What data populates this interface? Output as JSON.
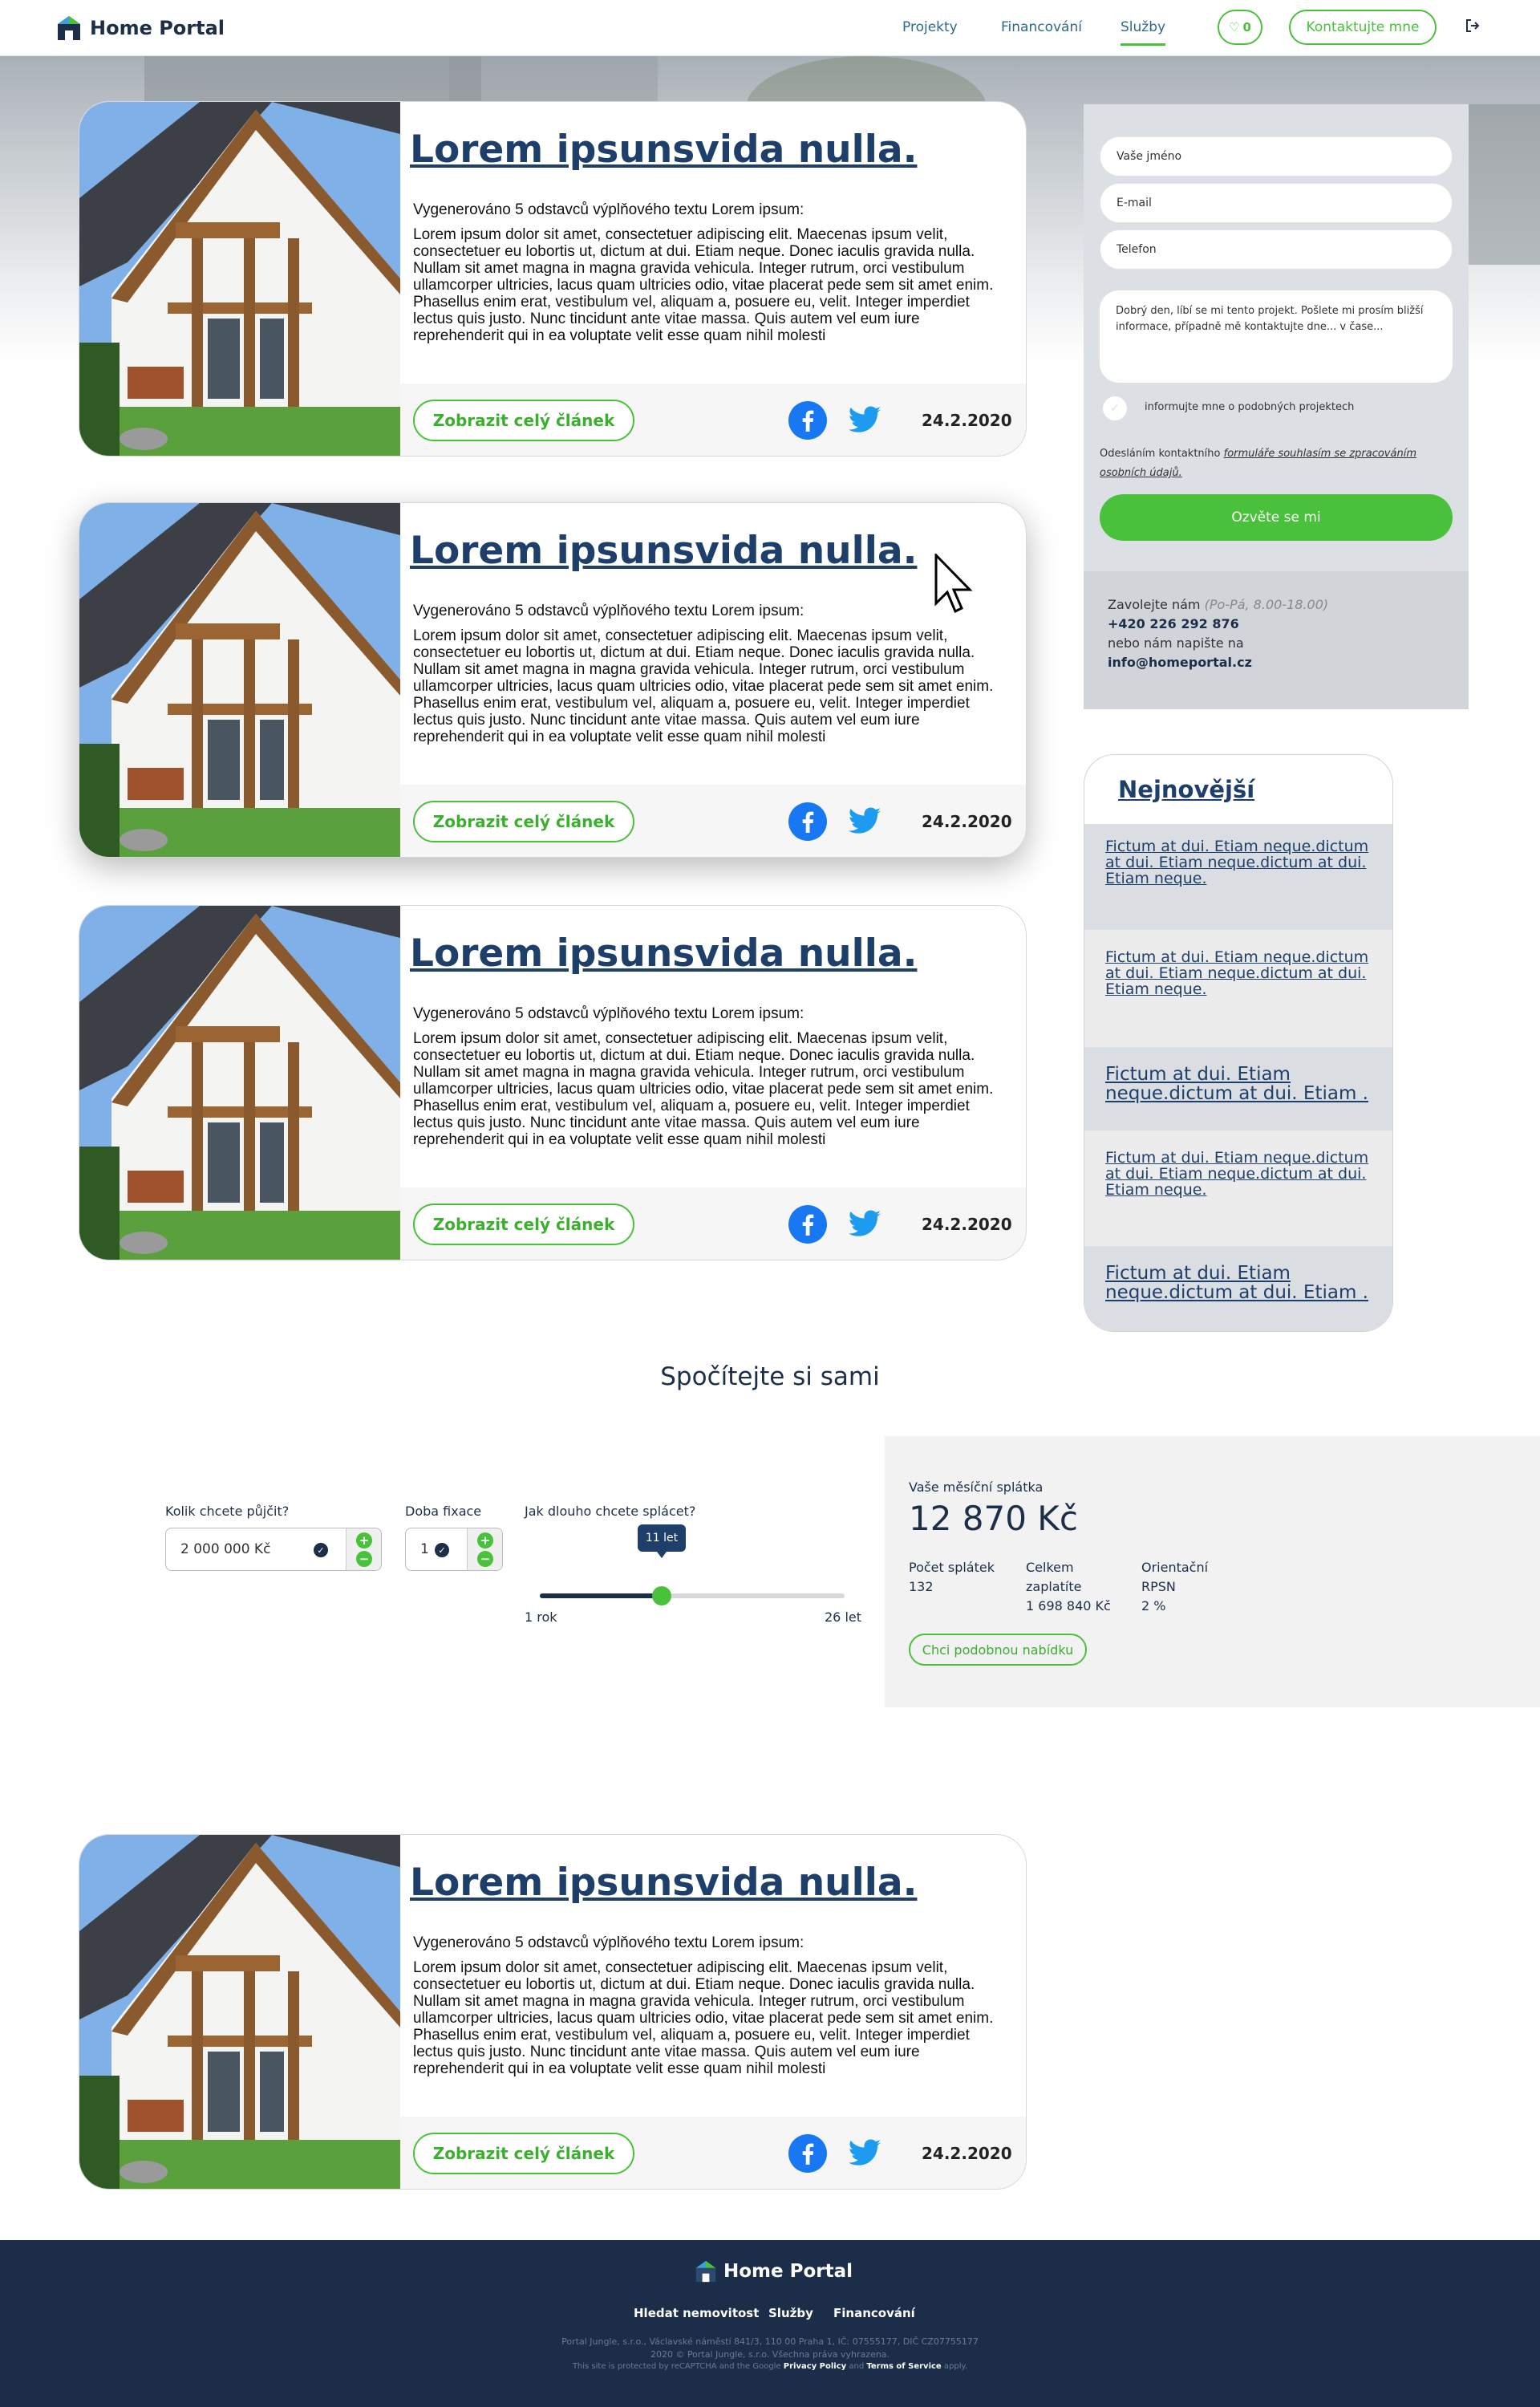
{
  "header": {
    "logo_text": "Home Portal",
    "nav": [
      "Projekty",
      "Financování",
      "Služby"
    ],
    "favorites_count": "0",
    "contact_label": "Kontaktujte mne"
  },
  "articles": [
    {
      "title": "Lorem ipsunsvida nulla.",
      "lead": "Vygenerováno 5 odstavců výplňového textu Lorem ipsum:",
      "text": "Lorem ipsum dolor sit amet, consectetuer adipiscing elit. Maecenas ipsum velit, consectetuer eu lobortis ut, dictum at dui. Etiam neque. Donec iaculis gravida nulla. Nullam sit amet magna in magna gravida vehicula. Integer rutrum, orci vestibulum ullamcorper ultricies, lacus quam ultricies odio, vitae placerat pede sem sit amet enim. Phasellus enim erat, vestibulum vel, aliquam a, posuere eu, velit. Integer imperdiet lectus quis justo. Nunc tincidunt ante vitae massa. Quis autem vel eum iure reprehenderit qui in ea voluptate velit esse quam nihil molesti",
      "button": "Zobrazit celý článek",
      "date": "24.2.2020"
    },
    {
      "title": "Lorem ipsunsvida nulla.",
      "lead": "Vygenerováno 5 odstavců výplňového textu Lorem ipsum:",
      "text": "Lorem ipsum dolor sit amet, consectetuer adipiscing elit. Maecenas ipsum velit, consectetuer eu lobortis ut, dictum at dui. Etiam neque. Donec iaculis gravida nulla. Nullam sit amet magna in magna gravida vehicula. Integer rutrum, orci vestibulum ullamcorper ultricies, lacus quam ultricies odio, vitae placerat pede sem sit amet enim. Phasellus enim erat, vestibulum vel, aliquam a, posuere eu, velit. Integer imperdiet lectus quis justo. Nunc tincidunt ante vitae massa. Quis autem vel eum iure reprehenderit qui in ea voluptate velit esse quam nihil molesti",
      "button": "Zobrazit celý článek",
      "date": "24.2.2020"
    },
    {
      "title": "Lorem ipsunsvida nulla.",
      "lead": "Vygenerováno 5 odstavců výplňového textu Lorem ipsum:",
      "text": "Lorem ipsum dolor sit amet, consectetuer adipiscing elit. Maecenas ipsum velit, consectetuer eu lobortis ut, dictum at dui. Etiam neque. Donec iaculis gravida nulla. Nullam sit amet magna in magna gravida vehicula. Integer rutrum, orci vestibulum ullamcorper ultricies, lacus quam ultricies odio, vitae placerat pede sem sit amet enim. Phasellus enim erat, vestibulum vel, aliquam a, posuere eu, velit. Integer imperdiet lectus quis justo. Nunc tincidunt ante vitae massa. Quis autem vel eum iure reprehenderit qui in ea voluptate velit esse quam nihil molesti",
      "button": "Zobrazit celý článek",
      "date": "24.2.2020"
    },
    {
      "title": "Lorem ipsunsvida nulla.",
      "lead": "Vygenerováno 5 odstavců výplňového textu Lorem ipsum:",
      "text": "Lorem ipsum dolor sit amet, consectetuer adipiscing elit. Maecenas ipsum velit, consectetuer eu lobortis ut, dictum at dui. Etiam neque. Donec iaculis gravida nulla. Nullam sit amet magna in magna gravida vehicula. Integer rutrum, orci vestibulum ullamcorper ultricies, lacus quam ultricies odio, vitae placerat pede sem sit amet enim. Phasellus enim erat, vestibulum vel, aliquam a, posuere eu, velit. Integer imperdiet lectus quis justo. Nunc tincidunt ante vitae massa. Quis autem vel eum iure reprehenderit qui in ea voluptate velit esse quam nihil molesti",
      "button": "Zobrazit celý článek",
      "date": "24.2.2020"
    }
  ],
  "form": {
    "name_placeholder": "Vaše jméno",
    "email_placeholder": "E-mail",
    "phone_placeholder": "Telefon",
    "message": "Dobrý den, líbí se mi tento projekt. Pošlete mi prosím bližší informace, případně mě kontaktujte dne... v čase...",
    "checkbox_label": "informujte mne o podobných projektech",
    "consent_prefix": "Odesláním kontaktního",
    "consent_link": "formuláře souhlasím se zpracováním osobních údajů.",
    "submit": "Ozvěte se mi",
    "call_label": "Zavolejte nám",
    "call_hours": "(Po-Pá, 8.00-18.00)",
    "phone": "+420 226 292 876",
    "or_write": "nebo nám napište na",
    "email": "info@homeportal.cz"
  },
  "newest": {
    "title": "Nejnovější",
    "items": [
      "Fictum at dui. Etiam neque.dictum at dui. Etiam neque.dictum at dui. Etiam neque.",
      "Fictum at dui. Etiam neque.dictum at dui. Etiam neque.dictum at dui. Etiam neque.",
      "Fictum at dui. Etiam neque.dictum at dui. Etiam .",
      "Fictum at dui. Etiam neque.dictum at dui. Etiam neque.dictum at dui. Etiam neque.",
      "Fictum at dui. Etiam neque.dictum at dui. Etiam ."
    ]
  },
  "calculator": {
    "heading": "Spočítejte si sami",
    "loan_label": "Kolik chcete půjčit?",
    "loan_value": "2 000 000 Kč",
    "fix_label": "Doba fixace",
    "fix_value": "1",
    "term_label": "Jak dlouho chcete splácet?",
    "term_value": "11 let",
    "term_min": "1 rok",
    "term_max": "26 let",
    "term_fraction": 0.4,
    "result_label": "Vaše měsíční splátka",
    "result_value": "12 870 Kč",
    "count_label": "Počet splátek",
    "count_value": "132",
    "total_label_1": "Celkem",
    "total_label_2": "zaplatíte",
    "total_value": "1 698 840 Kč",
    "rpsn_label_1": "Orientační",
    "rpsn_label_2": "RPSN",
    "rpsn_value": "2 %",
    "offer_button": "Chci podobnou nabídku"
  },
  "footer": {
    "logo_text": "Home Portal",
    "nav": [
      "Hledat nemovitost",
      "Služby",
      "Financování"
    ],
    "line1": "Portal Jungle, s.r.o., Václavské náměstí 841/3, 110 00 Praha 1, IČ: 07555177, DIČ CZ07755177",
    "line2": "2020 © Portal Jungle, s.r.o. Všechna práva vyhrazena.",
    "line3_a": "This site is protected by reCAPTCHA and the Google",
    "line3_privacy": "Privacy Policy",
    "line3_and": "and",
    "line3_terms": "Terms of Service",
    "line3_apply": "apply."
  },
  "colors": {
    "accent": "#49c13a",
    "navy": "#1d2e48",
    "title": "#1d3f6a",
    "facebook": "#3b5998",
    "twitter": "#1da1f2"
  }
}
